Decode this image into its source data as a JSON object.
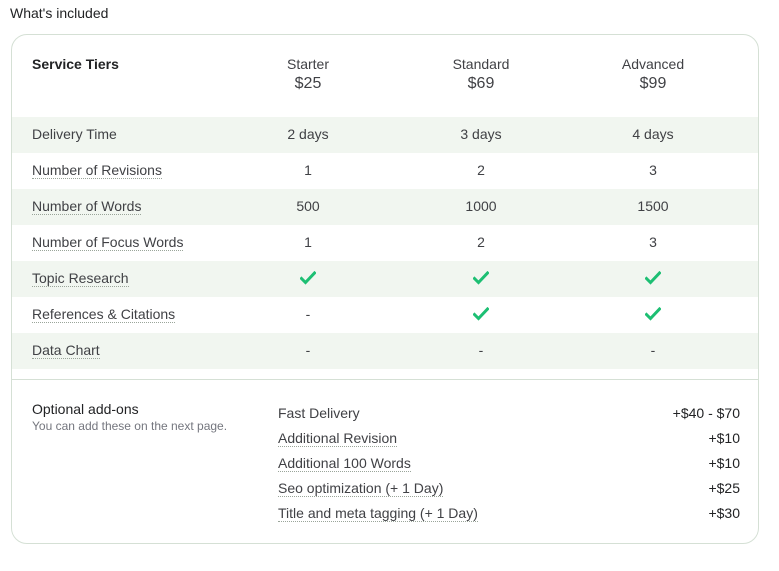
{
  "section_title": "What's included",
  "table": {
    "header_label": "Service Tiers",
    "tiers": [
      {
        "name": "Starter",
        "price": "$25"
      },
      {
        "name": "Standard",
        "price": "$69"
      },
      {
        "name": "Advanced",
        "price": "$99"
      }
    ],
    "rows": [
      {
        "label": "Delivery Time",
        "values": [
          "2 days",
          "3 days",
          "4 days"
        ],
        "dotted": false
      },
      {
        "label": "Number of Revisions",
        "values": [
          "1",
          "2",
          "3"
        ],
        "dotted": true
      },
      {
        "label": "Number of Words",
        "values": [
          "500",
          "1000",
          "1500"
        ],
        "dotted": true
      },
      {
        "label": "Number of Focus Words",
        "values": [
          "1",
          "2",
          "3"
        ],
        "dotted": true
      },
      {
        "label": "Topic Research",
        "values": [
          "check",
          "check",
          "check"
        ],
        "dotted": true
      },
      {
        "label": "References & Citations",
        "values": [
          "-",
          "check",
          "check"
        ],
        "dotted": true
      },
      {
        "label": "Data Chart",
        "values": [
          "-",
          "-",
          "-"
        ],
        "dotted": true
      }
    ]
  },
  "addons": {
    "title": "Optional add-ons",
    "subtitle": "You can add these on the next page.",
    "items": [
      {
        "name": "Fast Delivery",
        "price": "+$40 - $70",
        "dotted": false
      },
      {
        "name": "Additional Revision",
        "price": "+$10",
        "dotted": true
      },
      {
        "name": "Additional 100 Words",
        "price": "+$10",
        "dotted": true
      },
      {
        "name": "Seo optimization (+ 1 Day)",
        "price": "+$25",
        "dotted": true
      },
      {
        "name": "Title and meta tagging (+ 1 Day)",
        "price": "+$30",
        "dotted": true
      }
    ]
  },
  "colors": {
    "check": "#1dbf73",
    "row_shade": "#f1f6f0",
    "border": "#d5e0d5"
  }
}
